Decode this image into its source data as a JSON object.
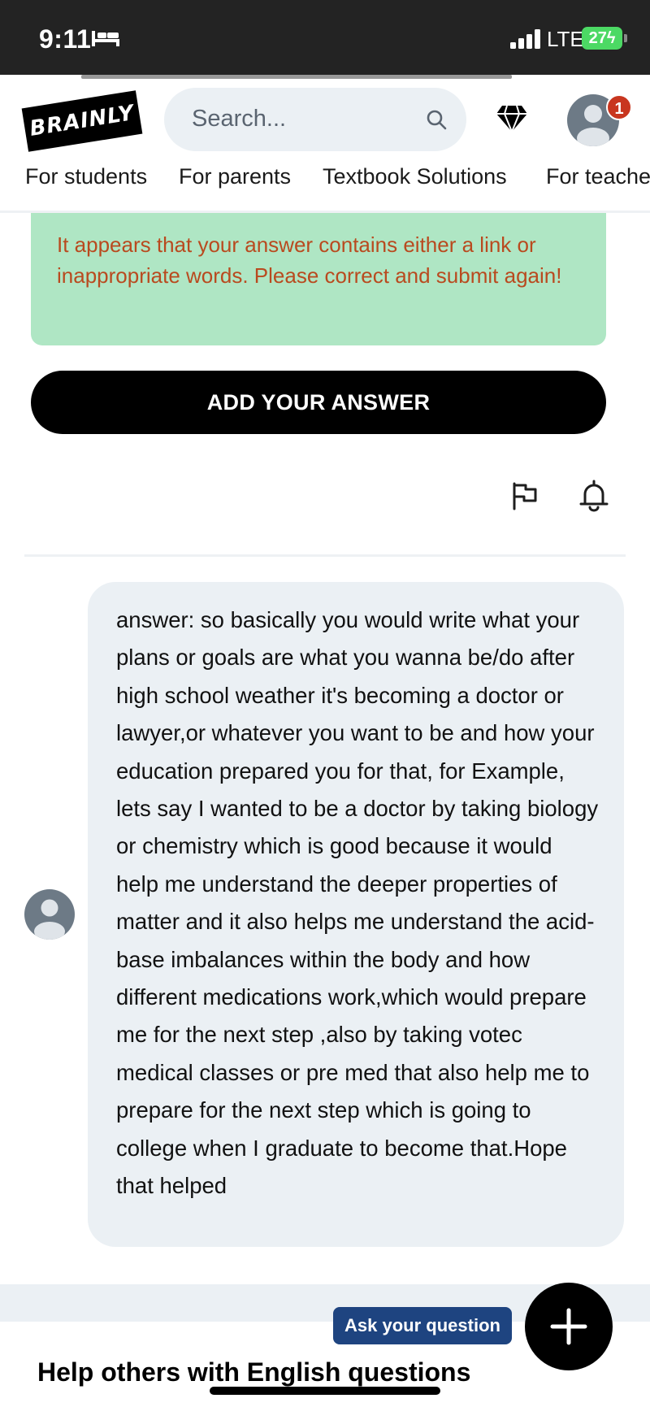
{
  "status_bar": {
    "time": "9:11",
    "network": "LTE",
    "battery": "27",
    "icons": [
      "sleep-mode-icon",
      "signal-icon",
      "battery-charging-icon"
    ]
  },
  "header": {
    "logo": "BRAINLY",
    "search": {
      "placeholder": "Search..."
    },
    "notification_count": "1",
    "icons": [
      "search-icon",
      "diamond-icon",
      "user-avatar-icon"
    ],
    "nav": [
      "For students",
      "For parents",
      "Textbook Solutions",
      "For teache"
    ]
  },
  "alert": {
    "message": "It appears that your answer contains either a link or inappropriate words. Please correct and submit again!"
  },
  "actions": {
    "add_answer": "ADD YOUR ANSWER",
    "icons": [
      "flag-icon",
      "bell-icon"
    ]
  },
  "answer": {
    "text": "answer: so basically you would write what your plans or goals are what you wanna be/do after high school weather it's becoming a doctor or lawyer,or whatever you want to be and how your education prepared you for that, for Example, lets say I wanted to be a doctor by taking biology or chemistry which is good because it would help me understand the deeper properties of matter and it also helps me understand the acid-base imbalances within the body and how different medications work,which would prepare me for the next step ,also by taking votec medical classes or pre med that also help me to prepare for the next step which is going to college when I graduate to become that.Hope that helped"
  },
  "footer": {
    "ask_question": "Ask your question",
    "help_heading": "Help others with English questions"
  },
  "colors": {
    "status_bar": "#232323",
    "alert_bg": "#afe6c4",
    "alert_text": "#b94a1f",
    "bubble_bg": "#ebf0f4",
    "ask_button": "#1e4480",
    "badge": "#c8361f",
    "battery": "#4cd964"
  }
}
